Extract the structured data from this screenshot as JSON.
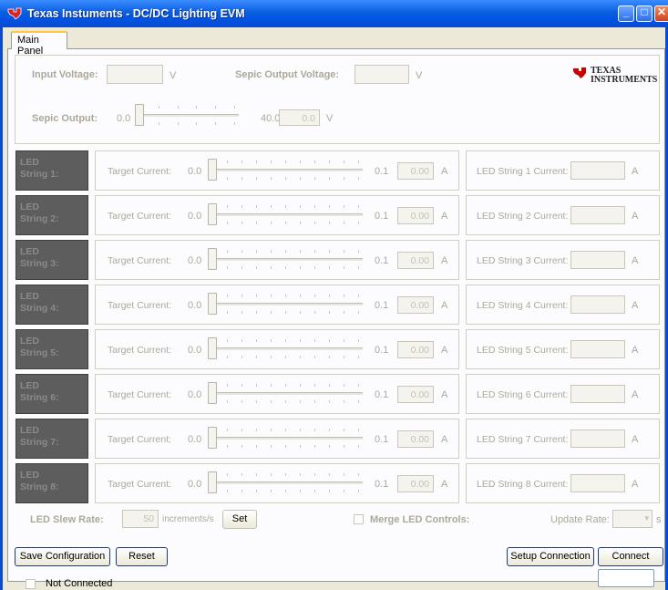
{
  "window": {
    "title": "Texas Instuments - DC/DC Lighting EVM",
    "app_icon": "ti-logo-icon",
    "controls": [
      "minimize-icon",
      "maximize-icon",
      "close-icon"
    ]
  },
  "tabs": [
    {
      "label": "Main Panel",
      "active": true
    }
  ],
  "header": {
    "input_voltage_label": "Input Voltage:",
    "input_voltage_value": "",
    "input_voltage_unit": "V",
    "sepic_output_voltage_label": "Sepic Output Voltage:",
    "sepic_output_voltage_value": "",
    "sepic_output_voltage_unit": "V",
    "logo_line1": "Texas",
    "logo_line2": "Instruments",
    "sepic_output_label": "Sepic Output:",
    "sepic_min": "0.0",
    "sepic_max": "40.0",
    "sepic_value": "0.0",
    "sepic_unit": "V",
    "sepic_level": 0
  },
  "strings": [
    {
      "tag1": "LED",
      "tag2": "String 1:",
      "target_label": "Target Current:",
      "min": "0.0",
      "max": "0.1",
      "value": "0.00",
      "unit": "A",
      "current_label": "LED String 1 Current:",
      "current_value": "",
      "current_unit": "A",
      "level": 0
    },
    {
      "tag1": "LED",
      "tag2": "String 2:",
      "target_label": "Target Current:",
      "min": "0.0",
      "max": "0.1",
      "value": "0.00",
      "unit": "A",
      "current_label": "LED String 2 Current:",
      "current_value": "",
      "current_unit": "A",
      "level": 0
    },
    {
      "tag1": "LED",
      "tag2": "String 3:",
      "target_label": "Target Current:",
      "min": "0.0",
      "max": "0.1",
      "value": "0.00",
      "unit": "A",
      "current_label": "LED String 3 Current:",
      "current_value": "",
      "current_unit": "A",
      "level": 0
    },
    {
      "tag1": "LED",
      "tag2": "String 4:",
      "target_label": "Target Current:",
      "min": "0.0",
      "max": "0.1",
      "value": "0.00",
      "unit": "A",
      "current_label": "LED String 4 Current:",
      "current_value": "",
      "current_unit": "A",
      "level": 0
    },
    {
      "tag1": "LED",
      "tag2": "String 5:",
      "target_label": "Target Current:",
      "min": "0.0",
      "max": "0.1",
      "value": "0.00",
      "unit": "A",
      "current_label": "LED String 5 Current:",
      "current_value": "",
      "current_unit": "A",
      "level": 0
    },
    {
      "tag1": "LED",
      "tag2": "String 6:",
      "target_label": "Target Current:",
      "min": "0.0",
      "max": "0.1",
      "value": "0.00",
      "unit": "A",
      "current_label": "LED String 6 Current:",
      "current_value": "",
      "current_unit": "A",
      "level": 0
    },
    {
      "tag1": "LED",
      "tag2": "String 7:",
      "target_label": "Target Current:",
      "min": "0.0",
      "max": "0.1",
      "value": "0.00",
      "unit": "A",
      "current_label": "LED String 7 Current:",
      "current_value": "",
      "current_unit": "A",
      "level": 0
    },
    {
      "tag1": "LED",
      "tag2": "String 8:",
      "target_label": "Target Current:",
      "min": "0.0",
      "max": "0.1",
      "value": "0.00",
      "unit": "A",
      "current_label": "LED String 8 Current:",
      "current_value": "",
      "current_unit": "A",
      "level": 0
    }
  ],
  "controls_row": {
    "slew_label": "LED Slew Rate:",
    "slew_value": "50",
    "slew_unit": "increments/s",
    "set_label": "Set",
    "merge_label": "Merge LED Controls:",
    "merge_checked": false,
    "update_rate_label": "Update Rate:",
    "update_rate_value": "",
    "update_rate_unit": "s"
  },
  "buttons": {
    "save": "Save Configuration",
    "reset": "Reset",
    "setup": "Setup Connection",
    "connect": "Connect"
  },
  "status": {
    "checked": false,
    "text": "Not Connected",
    "right_value": ""
  },
  "colors": {
    "title_bar": "#0054e3",
    "panel_bg": "#fcfcfe",
    "led_tag_bg": "#5d5d5d",
    "ti_red": "#cc0000"
  }
}
